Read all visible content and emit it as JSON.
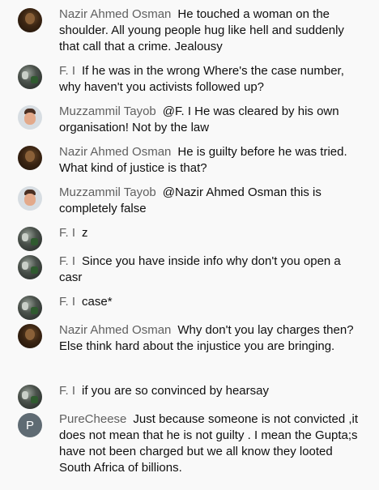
{
  "messages": [
    {
      "author": "Nazir Ahmed Osman",
      "avatar": "nazir",
      "text": "He touched a woman on the shoulder. All young people hug like hell and suddenly that call that a crime. Jealousy"
    },
    {
      "author": "F. I",
      "avatar": "fi",
      "text": "If he was in the wrong Where's the case number, why haven't you activists followed up?"
    },
    {
      "author": "Muzzammil Tayob",
      "avatar": "muzz",
      "text": "@F. I He was cleared by his own organisation! Not by the law"
    },
    {
      "author": "Nazir Ahmed Osman",
      "avatar": "nazir",
      "text": "He is guilty before he was tried. What kind of justice is that?"
    },
    {
      "author": "Muzzammil Tayob",
      "avatar": "muzz",
      "text": "@Nazir Ahmed Osman this is completely false"
    },
    {
      "author": "F. I",
      "avatar": "fi",
      "text": "z"
    },
    {
      "author": "F. I",
      "avatar": "fi",
      "text": "Since you have inside info why don't you open a casr"
    },
    {
      "author": "F. I",
      "avatar": "fi",
      "text": "case*"
    },
    {
      "author": "Nazir Ahmed Osman",
      "avatar": "nazir",
      "text": "Why don't you lay charges then? Else think hard about the injustice you are bringing."
    },
    {
      "author": "F. I",
      "avatar": "fi",
      "text": "if you are so convinced by hearsay"
    },
    {
      "author": "PureCheese",
      "avatar": "pure",
      "avatar_letter": "P",
      "text": "Just because someone is not convicted ,it does not mean that he is not guilty . I mean the Gupta;s have not been charged but we all know they looted South Africa of billions."
    }
  ]
}
